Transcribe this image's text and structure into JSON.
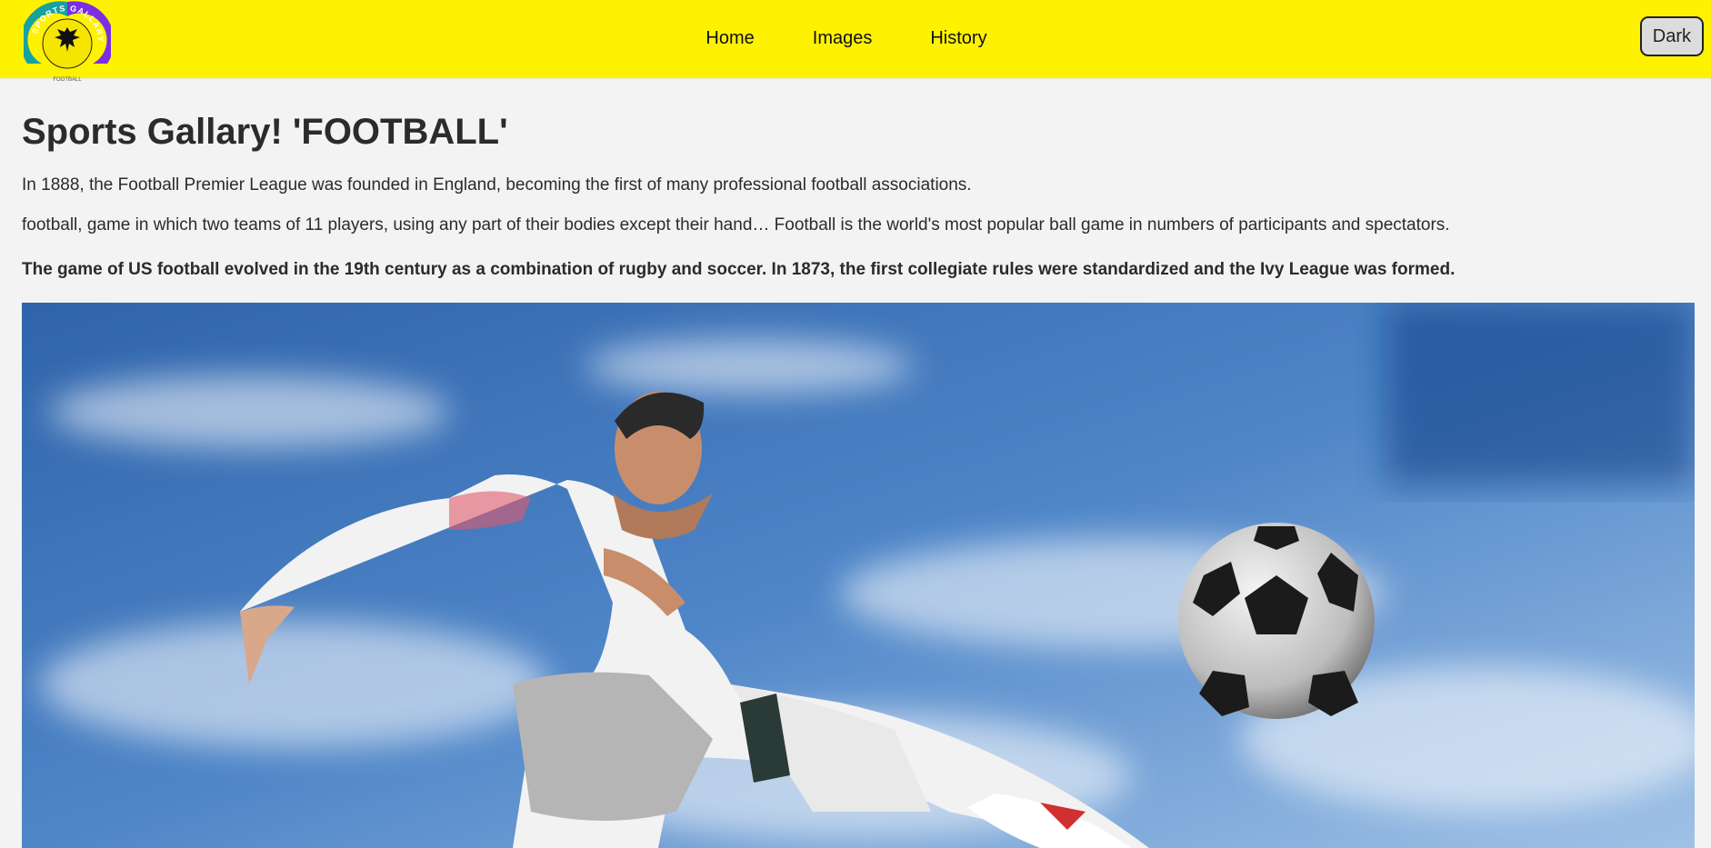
{
  "header": {
    "logo": {
      "ring_text": "SPORTS GALLARY",
      "subtext": "FOOTBALL",
      "colors": {
        "left": "#17a2a2",
        "right": "#7b2fe0",
        "center": "#f6e500"
      }
    },
    "nav": {
      "items": [
        "Home",
        "Images",
        "History"
      ]
    },
    "theme_button_label": "Dark",
    "background": "#fff200"
  },
  "main": {
    "title": "Sports Gallary! 'FOOTBALL'",
    "paragraphs": [
      "In 1888, the Football Premier League was founded in England, becoming the first of many professional football associations.",
      "football, game in which two teams of 11 players, using any part of their bodies except their hand… Football is the world's most popular ball game in numbers of participants and spectators.",
      "The game of US football evolved in the 19th century as a combination of rugby and soccer. In 1873, the first collegiate rules were standardized and the Ivy League was formed."
    ],
    "hero_image": {
      "subject": "football-player-kicking-ball",
      "sky": "#3a6fb6"
    }
  }
}
